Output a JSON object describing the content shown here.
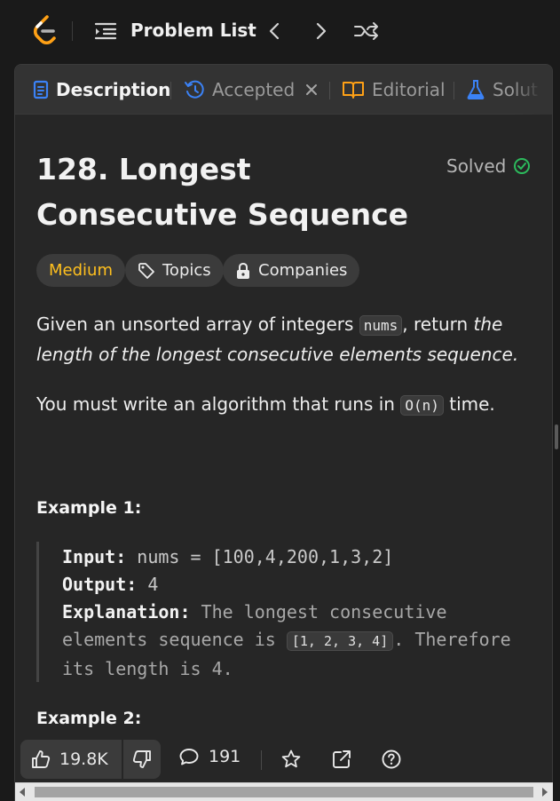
{
  "nav": {
    "problem_list_label": "Problem List"
  },
  "tabs": [
    {
      "label": "Description",
      "icon": "description-icon"
    },
    {
      "label": "Accepted",
      "icon": "history-icon"
    },
    {
      "label": "Editorial",
      "icon": "book-icon"
    },
    {
      "label": "Solut",
      "icon": "flask-icon"
    }
  ],
  "problem": {
    "title": "128. Longest Consecutive Sequence",
    "status": "Solved",
    "difficulty": "Medium",
    "topics_label": "Topics",
    "companies_label": "Companies",
    "desc1_pre": "Given an unsorted array of integers ",
    "desc1_code": "nums",
    "desc1_mid": ", return ",
    "desc1_em": "the length of the longest consecutive elements sequence.",
    "desc2_pre": "You must write an algorithm that runs in ",
    "desc2_code": "O(n)",
    "desc2_post": " time."
  },
  "example1": {
    "heading": "Example 1:",
    "input_label": "Input:",
    "input_value": "nums = [100,4,200,1,3,2]",
    "output_label": "Output:",
    "output_value": "4",
    "explanation_label": "Explanation:",
    "explanation_pre": "The longest consecutive elements sequence is ",
    "explanation_code": "[1, 2, 3, 4]",
    "explanation_post": ". Therefore its length is 4."
  },
  "example2": {
    "heading": "Example 2:"
  },
  "actions": {
    "likes": "19.8K",
    "comments": "191"
  },
  "colors": {
    "accent_orange": "#ffa116",
    "difficulty_medium": "#ffc01e",
    "solved_green": "#2cbb5d",
    "tab_blue": "#3b82f6",
    "editorial_orange": "#ffa116"
  }
}
